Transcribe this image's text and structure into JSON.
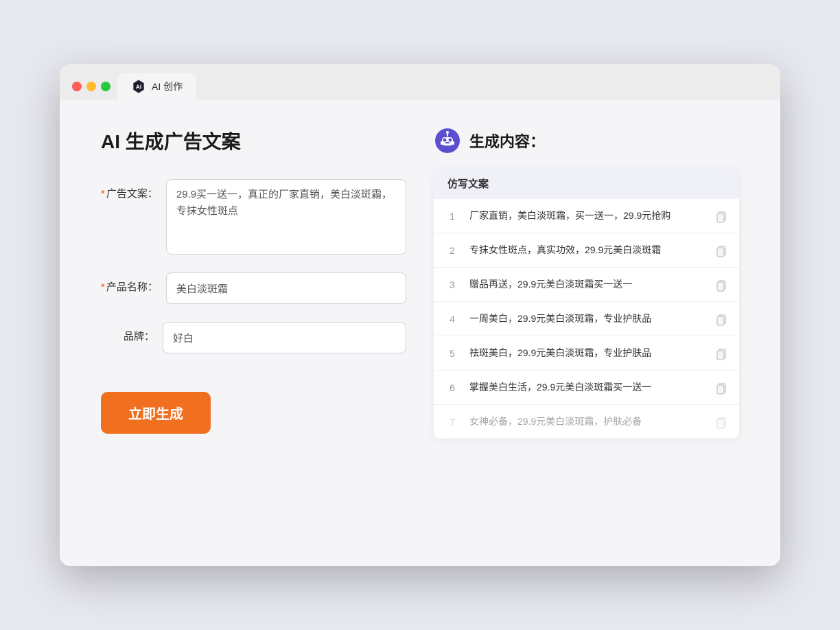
{
  "browser": {
    "tab_label": "AI 创作",
    "traffic_lights": [
      "red",
      "yellow",
      "green"
    ]
  },
  "left_panel": {
    "title": "AI 生成广告文案",
    "fields": [
      {
        "id": "ad_copy",
        "label": "广告文案：",
        "required": true,
        "type": "textarea",
        "value": "29.9买一送一，真正的厂家直销，美白淡斑霜，专抹女性斑点"
      },
      {
        "id": "product_name",
        "label": "产品名称：",
        "required": true,
        "type": "input",
        "value": "美白淡斑霜"
      },
      {
        "id": "brand",
        "label": "品牌：",
        "required": false,
        "type": "input",
        "value": "好白"
      }
    ],
    "generate_button": "立即生成"
  },
  "right_panel": {
    "title": "生成内容：",
    "table_header": "仿写文案",
    "results": [
      {
        "num": 1,
        "text": "厂家直销，美白淡斑霜，买一送一，29.9元抢购",
        "faded": false
      },
      {
        "num": 2,
        "text": "专抹女性斑点，真实功效，29.9元美白淡斑霜",
        "faded": false
      },
      {
        "num": 3,
        "text": "赠品再送，29.9元美白淡斑霜买一送一",
        "faded": false
      },
      {
        "num": 4,
        "text": "一周美白，29.9元美白淡斑霜，专业护肤品",
        "faded": false
      },
      {
        "num": 5,
        "text": "祛斑美白，29.9元美白淡斑霜，专业护肤品",
        "faded": false
      },
      {
        "num": 6,
        "text": "掌握美白生活，29.9元美白淡斑霜买一送一",
        "faded": false
      },
      {
        "num": 7,
        "text": "女神必备，29.9元美白淡斑霜，护肤必备",
        "faded": true
      }
    ]
  }
}
